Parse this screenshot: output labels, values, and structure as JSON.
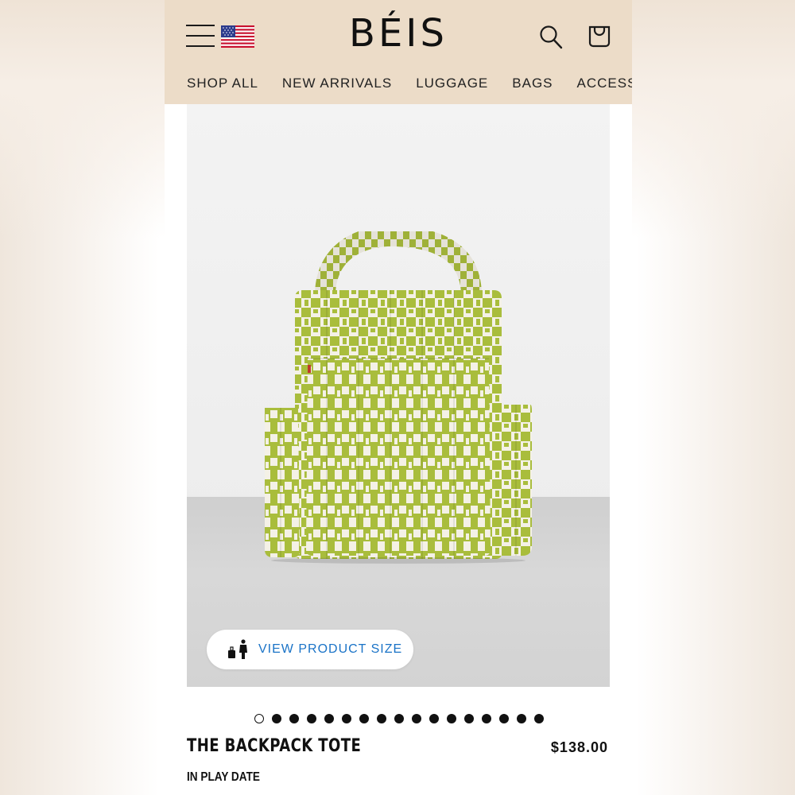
{
  "header": {
    "logo": "BÉIS",
    "nav": [
      "SHOP ALL",
      "NEW ARRIVALS",
      "LUGGAGE",
      "BAGS",
      "ACCESS"
    ]
  },
  "product": {
    "size_button_label": "VIEW PRODUCT SIZE",
    "carousel": {
      "total": 17,
      "active_index": 0
    },
    "title": "THE BACKPACK TOTE",
    "price": "$138.00",
    "variant": "IN PLAY DATE",
    "colors": {
      "primary": "#a9bd3c",
      "secondary": "#f4f1e6"
    }
  }
}
